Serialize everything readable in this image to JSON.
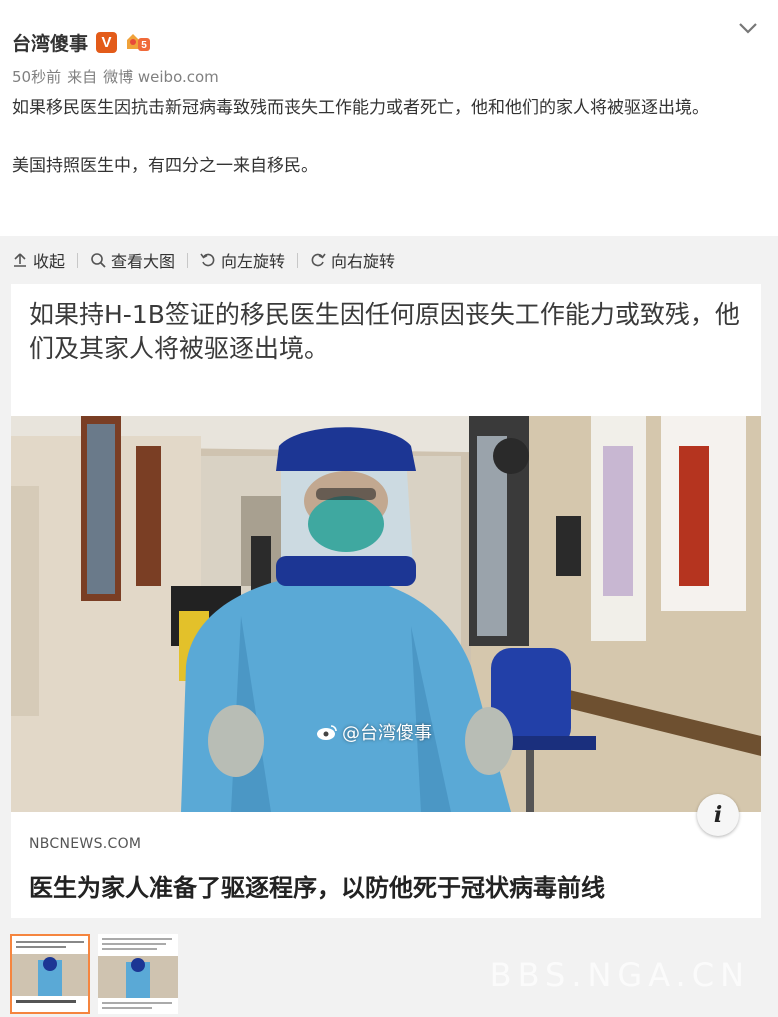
{
  "post": {
    "author": "台湾傻事",
    "verified_badge": "V",
    "level_badge": "5",
    "time": "50秒前",
    "source_prefix": "来自",
    "source_app": "微博 weibo.com",
    "text_line1": "如果移民医生因抗击新冠病毒致残而丧失工作能力或者死亡，他和他们的家人将被驱逐出境。",
    "text_line2": "美国持照医生中，有四分之一来自移民。"
  },
  "toolbar": {
    "collapse_label": "收起",
    "view_large_label": "查看大图",
    "rotate_left_label": "向左旋转",
    "rotate_right_label": "向右旋转"
  },
  "article": {
    "headline": "如果持H-1B签证的移民医生因任何原因丧失工作能力或致残，他们及其家人将被驱逐出境。",
    "watermark": "@台湾傻事",
    "info_icon": "i",
    "site": "NBCNEWS.COM",
    "caption": "医生为家人准备了驱逐程序，以防他死于冠状病毒前线"
  },
  "gallery_watermark": "BBS.NGA.CN",
  "colors": {
    "accent": "#f5853f",
    "verified": "#e35b19",
    "gown": "#5aa9d6"
  }
}
